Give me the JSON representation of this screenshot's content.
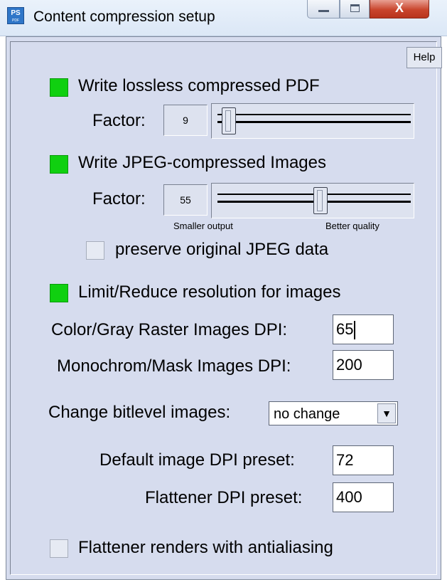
{
  "window": {
    "title": "Content compression setup",
    "icon_text": "PS",
    "icon_subtext": "PDF",
    "close_glyph": "X"
  },
  "help_label": "Help",
  "lossless": {
    "enabled": true,
    "label": "Write lossless compressed PDF",
    "factor_label": "Factor:",
    "factor_value": "9",
    "slider_level": 0.04
  },
  "jpeg": {
    "enabled": true,
    "label": "Write JPEG-compressed Images",
    "factor_label": "Factor:",
    "factor_value": "55",
    "slider_level": 0.55,
    "min_caption": "Smaller output",
    "max_caption": "Better quality",
    "preserve_label": "preserve original JPEG data",
    "preserve_checked": false
  },
  "resolution": {
    "enabled": true,
    "label": "Limit/Reduce resolution for images",
    "color_dpi_label": "Color/Gray Raster Images DPI:",
    "color_dpi_value": "65",
    "mono_dpi_label": "Monochrom/Mask Images DPI:",
    "mono_dpi_value": "200"
  },
  "bitlevel": {
    "label": "Change bitlevel images:",
    "selected": "no change",
    "arrow_glyph": "▼"
  },
  "presets": {
    "default_dpi_label": "Default image DPI preset:",
    "default_dpi_value": "72",
    "flattener_dpi_label": "Flattener DPI preset:",
    "flattener_dpi_value": "400"
  },
  "antialias": {
    "label": "Flattener renders with antialiasing",
    "checked": false
  },
  "colors": {
    "led_on": "#10d010",
    "dialog_bg": "#d6dcee"
  }
}
